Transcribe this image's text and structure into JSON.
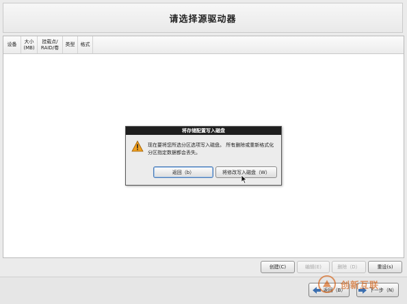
{
  "window": {
    "title": "请选择源驱动器"
  },
  "table": {
    "columns": [
      "设备",
      "大小\n(MB)",
      "挂载点/\nRAID/卷",
      "类型",
      "格式"
    ]
  },
  "dialog": {
    "title": "将存储配置写入磁盘",
    "message": "现在要将您所选分区选项写入磁盘。 所有删除或重新格式化分区指定数据都会丢失。",
    "back_button": "返回（b）",
    "write_button": "将修改写入磁盘（W）",
    "icon": "warning-icon"
  },
  "actions": {
    "create": "创建(C)",
    "edit": "编辑(E)",
    "delete": "删除（D）",
    "reset": "重设(s)"
  },
  "nav": {
    "back": "返回（B）",
    "next": "下一步（N）"
  },
  "watermark": {
    "text": "创新互联"
  },
  "colors": {
    "dialog_title_bg": "#1e1e1e",
    "warning": "#f0a020",
    "watermark": "#d35400"
  }
}
